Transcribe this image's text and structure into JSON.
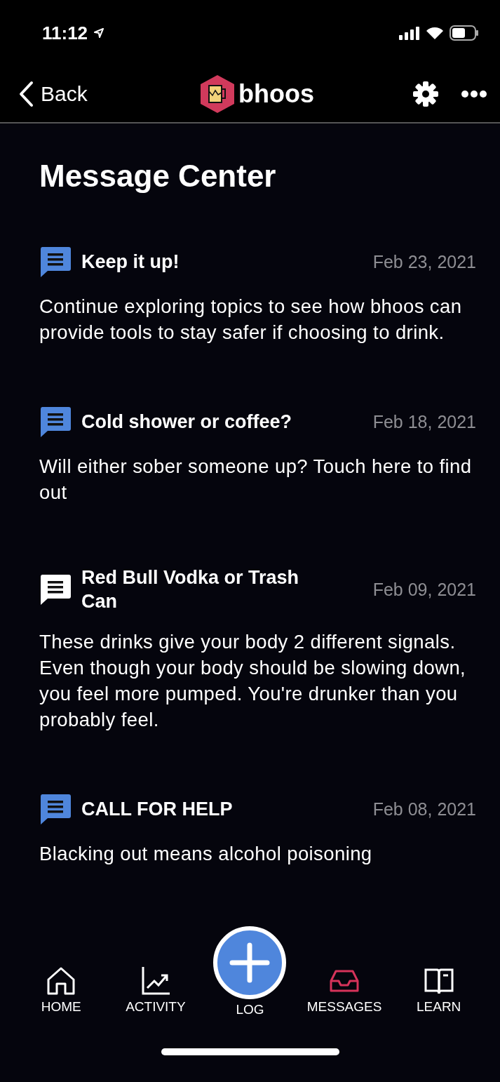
{
  "status_bar": {
    "time": "11:12"
  },
  "nav": {
    "back": "Back",
    "brand": "bhoos"
  },
  "title": "Message Center",
  "messages": [
    {
      "title": "Keep it up!",
      "date": "Feb 23, 2021",
      "body": "Continue exploring topics to see how bhoos can provide tools to stay safer if choosing to drink.",
      "read": false
    },
    {
      "title": "Cold shower or coffee?",
      "date": "Feb 18, 2021",
      "body": "Will either sober someone up?  Touch here to find out",
      "read": false
    },
    {
      "title": "Red Bull Vodka or Trash Can",
      "date": "Feb 09, 2021",
      "body": "These drinks give your body 2 different signals. Even though your body should be slowing down, you feel more pumped. You're drunker than you probably feel.",
      "read": true
    },
    {
      "title": "CALL FOR HELP",
      "date": "Feb 08, 2021",
      "body": "Blacking out means alcohol poisoning",
      "read": false
    }
  ],
  "tab_bar": [
    {
      "kind": "home",
      "label": "HOME",
      "selected": false
    },
    {
      "kind": "activity",
      "label": "ACTIVITY",
      "selected": false
    },
    {
      "kind": "log",
      "label": "LOG",
      "selected": false
    },
    {
      "kind": "messages",
      "label": "MESSAGES",
      "selected": true
    },
    {
      "kind": "learn",
      "label": "LEARN",
      "selected": false
    }
  ]
}
